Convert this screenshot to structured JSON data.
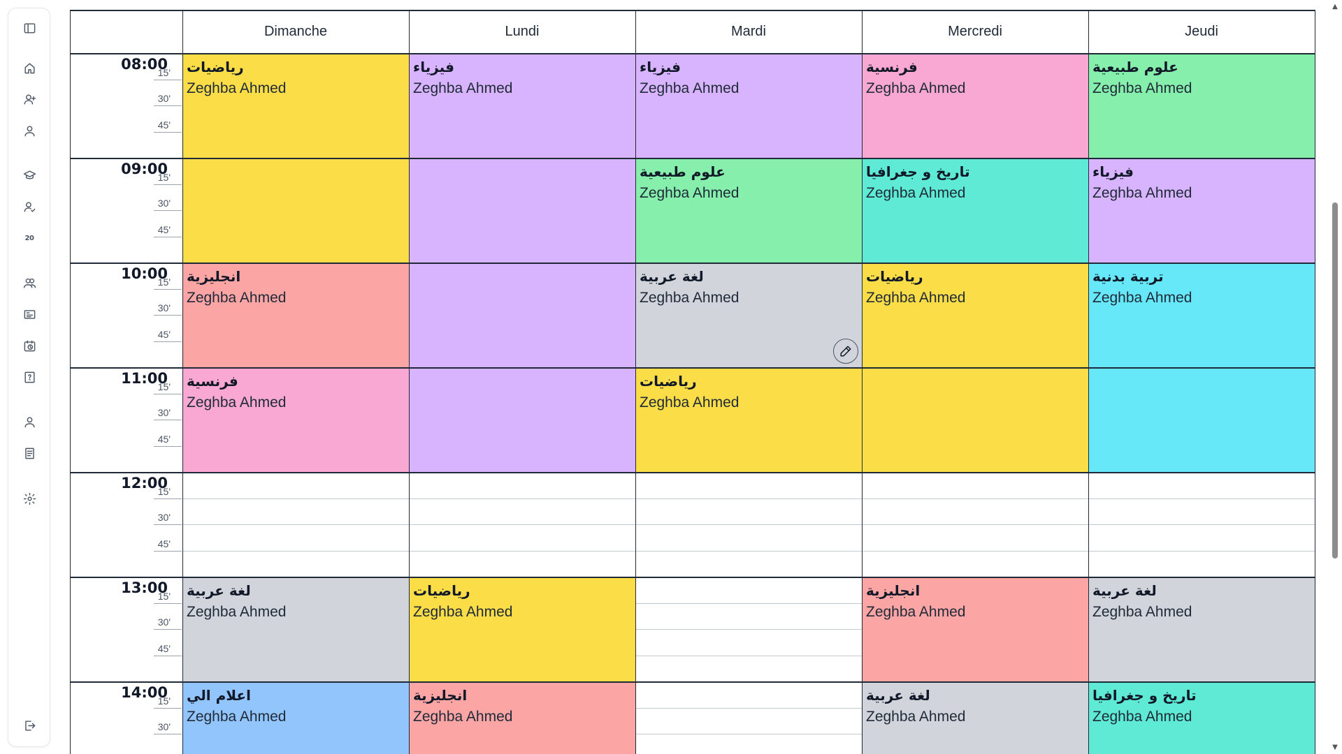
{
  "days": [
    "Dimanche",
    "Lundi",
    "Mardi",
    "Mercredi",
    "Jeudi"
  ],
  "hours": [
    "08:00",
    "09:00",
    "10:00",
    "11:00",
    "12:00",
    "13:00",
    "14:00"
  ],
  "minute_marks": [
    "15'",
    "30'",
    "45'"
  ],
  "colors": {
    "math": "#fbdd48",
    "physics": "#d8b4fe",
    "french": "#f9a8d4",
    "science": "#86efac",
    "history": "#5eead4",
    "arabic": "#d1d5db",
    "english": "#fca5a5",
    "sport": "#67e8f9",
    "informatics": "#93c5fd"
  },
  "events": [
    {
      "day": 0,
      "start": "08:00",
      "end": "10:00",
      "subject": "رياضيات",
      "teacher": "Zeghba Ahmed",
      "color": "#fbdd48"
    },
    {
      "day": 0,
      "start": "10:00",
      "end": "11:00",
      "subject": "انجليزية",
      "teacher": "Zeghba Ahmed",
      "color": "#fca5a5"
    },
    {
      "day": 0,
      "start": "11:00",
      "end": "12:00",
      "subject": "فرنسية",
      "teacher": "Zeghba Ahmed",
      "color": "#f9a8d4"
    },
    {
      "day": 0,
      "start": "13:00",
      "end": "14:00",
      "subject": "لغة عربية",
      "teacher": "Zeghba Ahmed",
      "color": "#d1d5db"
    },
    {
      "day": 0,
      "start": "14:00",
      "end": "15:00",
      "subject": "اعلام الي",
      "teacher": "Zeghba Ahmed",
      "color": "#93c5fd"
    },
    {
      "day": 1,
      "start": "08:00",
      "end": "12:00",
      "subject": "فيزياء",
      "teacher": "Zeghba Ahmed",
      "color": "#d8b4fe"
    },
    {
      "day": 1,
      "start": "13:00",
      "end": "14:00",
      "subject": "رياضيات",
      "teacher": "Zeghba Ahmed",
      "color": "#fbdd48"
    },
    {
      "day": 1,
      "start": "14:00",
      "end": "15:00",
      "subject": "انجليزية",
      "teacher": "Zeghba Ahmed",
      "color": "#fca5a5"
    },
    {
      "day": 2,
      "start": "08:00",
      "end": "09:00",
      "subject": "فيزياء",
      "teacher": "Zeghba Ahmed",
      "color": "#d8b4fe"
    },
    {
      "day": 2,
      "start": "09:00",
      "end": "10:00",
      "subject": "علوم طبيعية",
      "teacher": "Zeghba Ahmed",
      "color": "#86efac"
    },
    {
      "day": 2,
      "start": "10:00",
      "end": "11:00",
      "subject": "لغة عربية",
      "teacher": "Zeghba Ahmed",
      "color": "#d1d5db",
      "edit": true
    },
    {
      "day": 2,
      "start": "11:00",
      "end": "12:00",
      "subject": "رياضيات",
      "teacher": "Zeghba Ahmed",
      "color": "#fbdd48"
    },
    {
      "day": 3,
      "start": "08:00",
      "end": "09:00",
      "subject": "فرنسية",
      "teacher": "Zeghba Ahmed",
      "color": "#f9a8d4"
    },
    {
      "day": 3,
      "start": "09:00",
      "end": "10:00",
      "subject": "تاريخ و جغرافيا",
      "teacher": "Zeghba Ahmed",
      "color": "#5eead4"
    },
    {
      "day": 3,
      "start": "10:00",
      "end": "12:00",
      "subject": "رياضيات",
      "teacher": "Zeghba Ahmed",
      "color": "#fbdd48"
    },
    {
      "day": 3,
      "start": "13:00",
      "end": "14:00",
      "subject": "انجليزية",
      "teacher": "Zeghba Ahmed",
      "color": "#fca5a5"
    },
    {
      "day": 3,
      "start": "14:00",
      "end": "15:00",
      "subject": "لغة عربية",
      "teacher": "Zeghba Ahmed",
      "color": "#d1d5db"
    },
    {
      "day": 4,
      "start": "08:00",
      "end": "09:00",
      "subject": "علوم طبيعية",
      "teacher": "Zeghba Ahmed",
      "color": "#86efac"
    },
    {
      "day": 4,
      "start": "09:00",
      "end": "10:00",
      "subject": "فيزياء",
      "teacher": "Zeghba Ahmed",
      "color": "#d8b4fe"
    },
    {
      "day": 4,
      "start": "10:00",
      "end": "12:00",
      "subject": "تربية بدنية",
      "teacher": "Zeghba Ahmed",
      "color": "#67e8f9"
    },
    {
      "day": 4,
      "start": "13:00",
      "end": "14:00",
      "subject": "لغة عربية",
      "teacher": "Zeghba Ahmed",
      "color": "#d1d5db"
    },
    {
      "day": 4,
      "start": "14:00",
      "end": "15:00",
      "subject": "تاريخ و جغرافيا",
      "teacher": "Zeghba Ahmed",
      "color": "#5eead4"
    }
  ],
  "sidebar": {
    "icons": [
      "sidebar-toggle-icon",
      "home-icon",
      "add-user-icon",
      "user-icon",
      "graduation-cap-icon",
      "user-check-icon",
      "number-20-icon",
      "users-icon",
      "id-card-icon",
      "calendar-clock-icon",
      "book-question-icon",
      "profile-icon",
      "document-icon",
      "settings-icon",
      "logout-icon"
    ],
    "number_badge": "20"
  }
}
